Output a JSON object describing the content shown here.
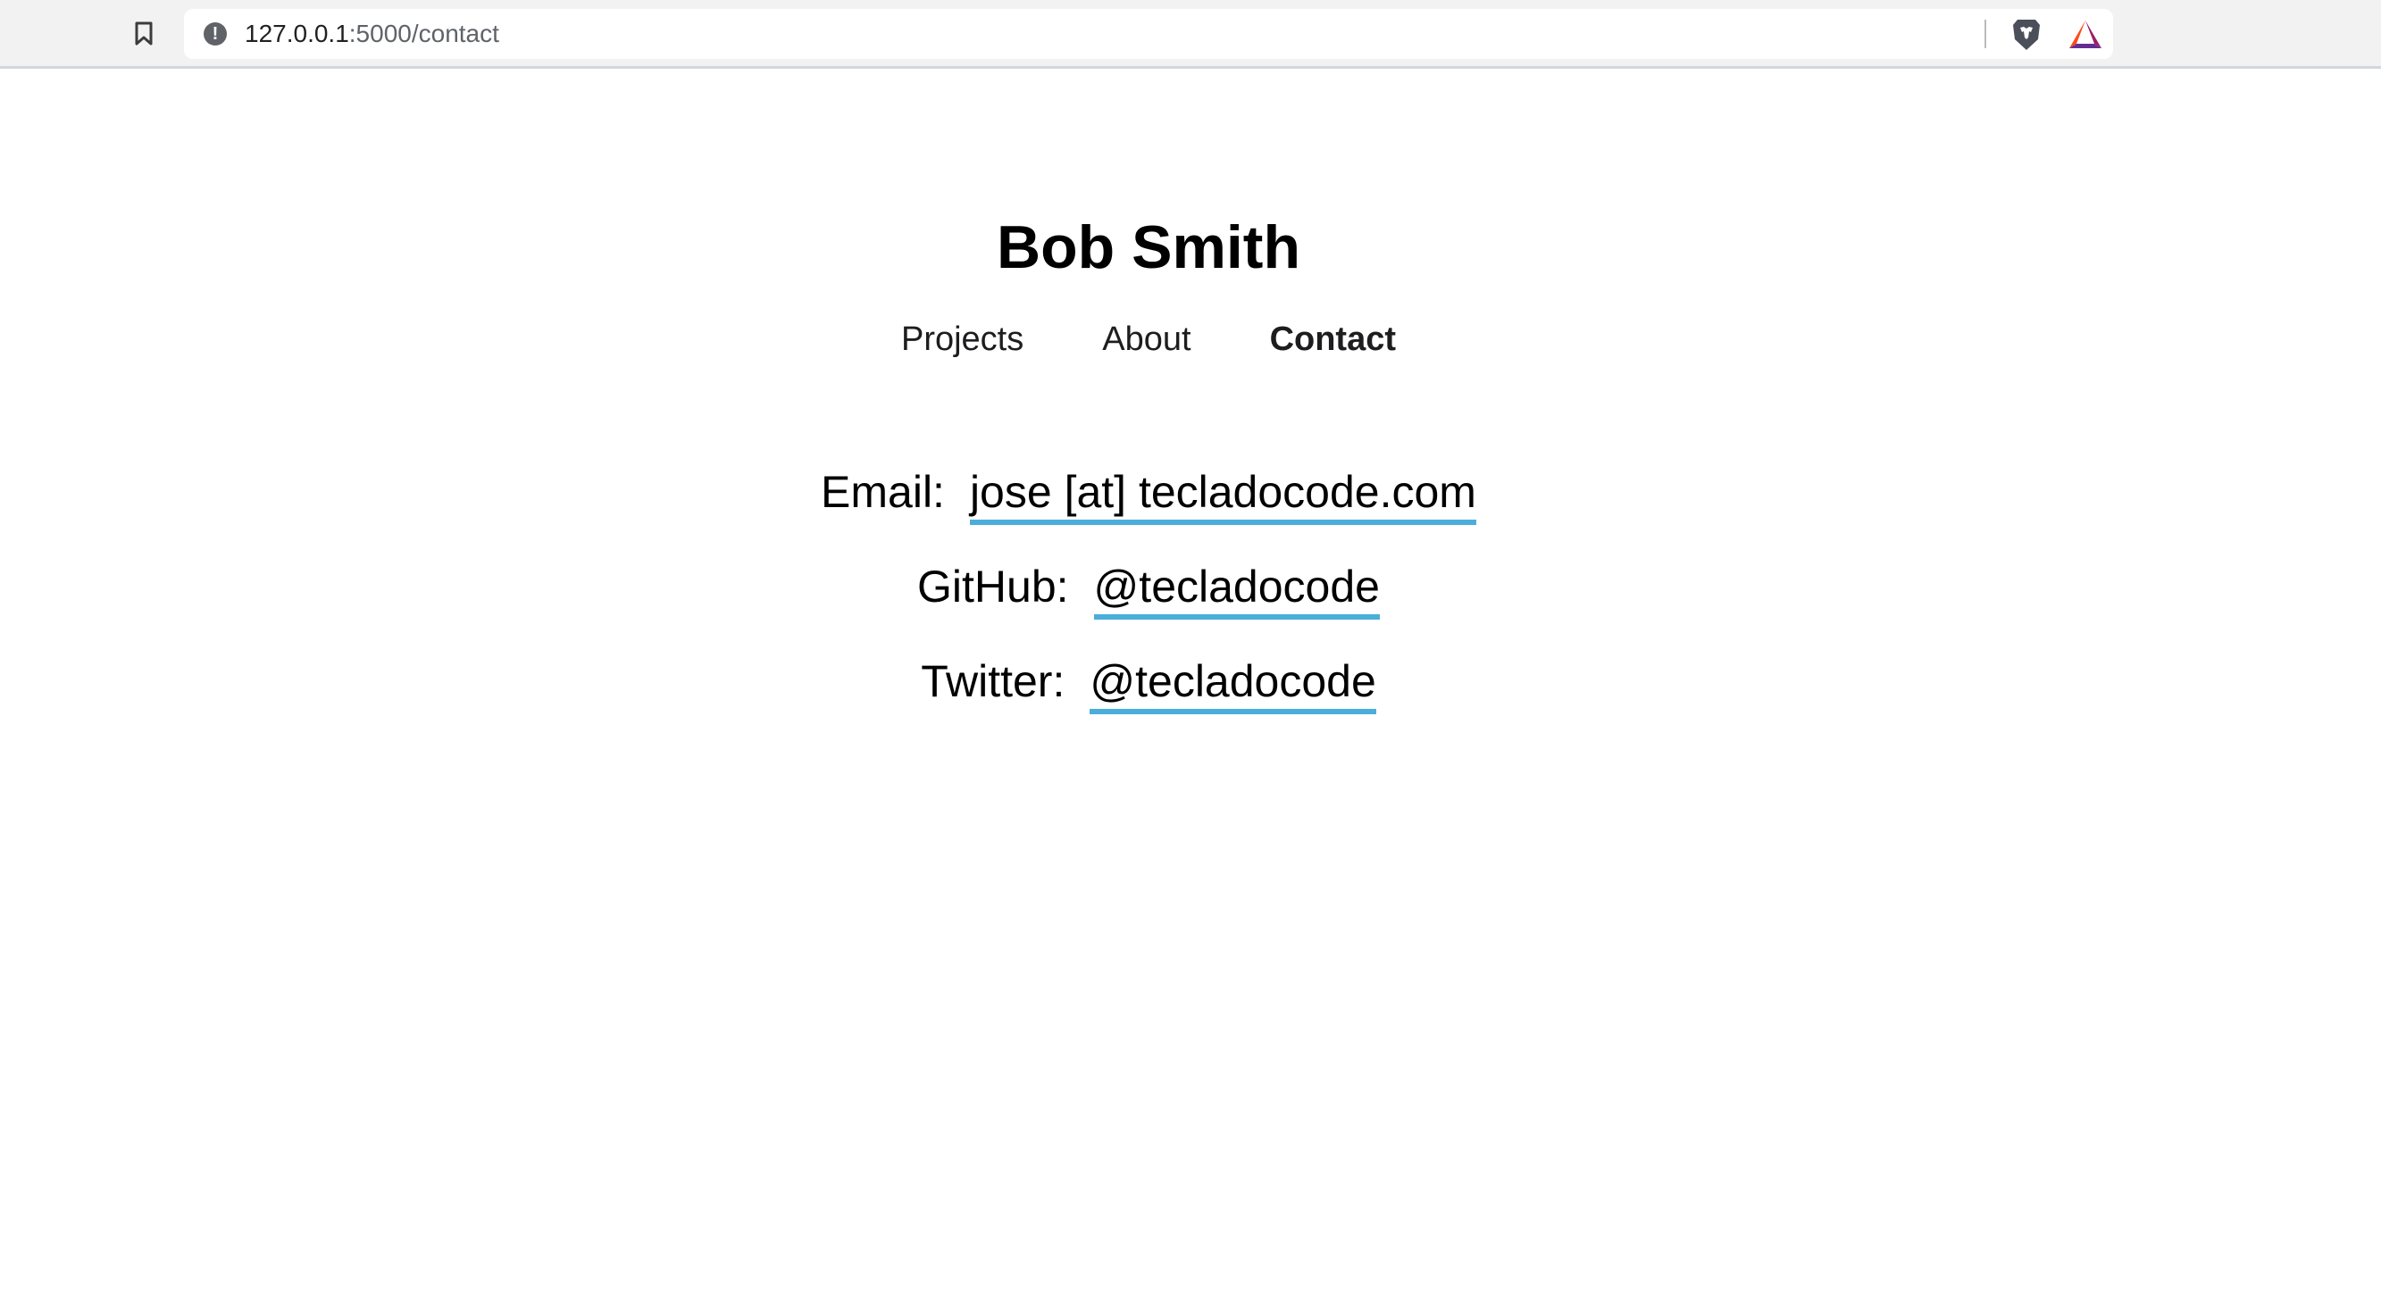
{
  "browser": {
    "url_host": "127.0.0.1",
    "url_path": ":5000/contact",
    "icons": [
      "bookmark-icon",
      "info-icon",
      "brave-shield-icon",
      "bat-rewards-icon"
    ],
    "info_glyph": "!"
  },
  "site": {
    "title": "Bob Smith",
    "nav": [
      {
        "label": "Projects",
        "active": false
      },
      {
        "label": "About",
        "active": false
      },
      {
        "label": "Contact",
        "active": true
      }
    ]
  },
  "contacts": [
    {
      "label": "Email:",
      "value": "jose [at] tecladocode.com"
    },
    {
      "label": "GitHub:",
      "value": "@tecladocode"
    },
    {
      "label": "Twitter:",
      "value": "@tecladocode"
    }
  ],
  "colors": {
    "link_underline": "#4aaedb",
    "toolbar_bg": "#f2f2f2"
  }
}
